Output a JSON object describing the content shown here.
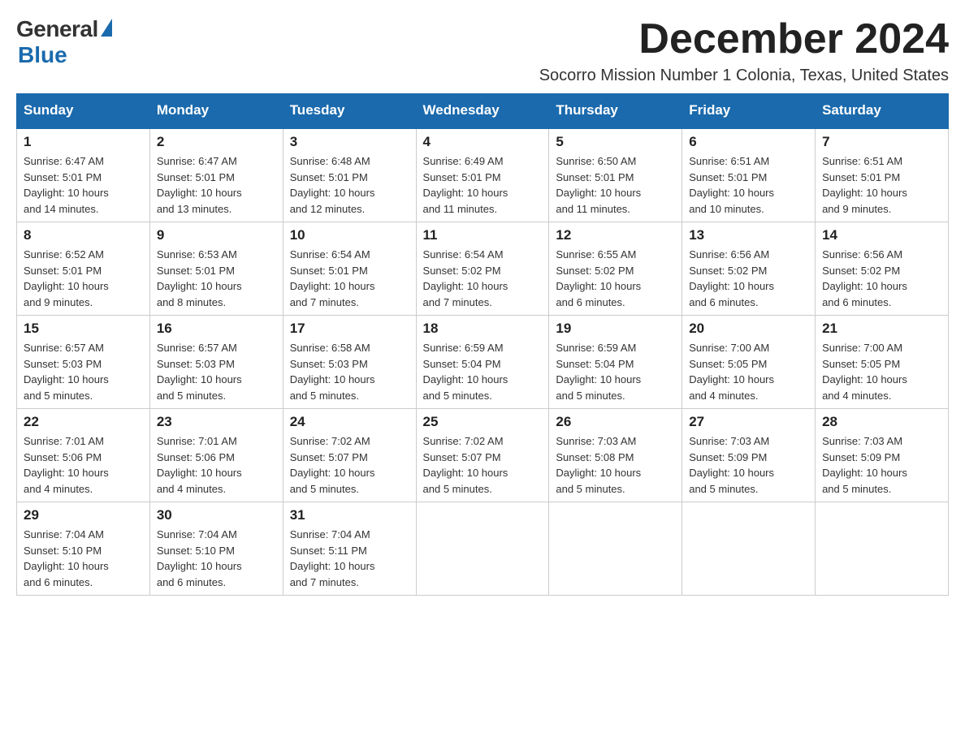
{
  "logo": {
    "general": "General",
    "blue": "Blue"
  },
  "title": "December 2024",
  "subtitle": "Socorro Mission Number 1 Colonia, Texas, United States",
  "weekdays": [
    "Sunday",
    "Monday",
    "Tuesday",
    "Wednesday",
    "Thursday",
    "Friday",
    "Saturday"
  ],
  "weeks": [
    [
      {
        "day": "1",
        "sunrise": "6:47 AM",
        "sunset": "5:01 PM",
        "daylight": "10 hours and 14 minutes."
      },
      {
        "day": "2",
        "sunrise": "6:47 AM",
        "sunset": "5:01 PM",
        "daylight": "10 hours and 13 minutes."
      },
      {
        "day": "3",
        "sunrise": "6:48 AM",
        "sunset": "5:01 PM",
        "daylight": "10 hours and 12 minutes."
      },
      {
        "day": "4",
        "sunrise": "6:49 AM",
        "sunset": "5:01 PM",
        "daylight": "10 hours and 11 minutes."
      },
      {
        "day": "5",
        "sunrise": "6:50 AM",
        "sunset": "5:01 PM",
        "daylight": "10 hours and 11 minutes."
      },
      {
        "day": "6",
        "sunrise": "6:51 AM",
        "sunset": "5:01 PM",
        "daylight": "10 hours and 10 minutes."
      },
      {
        "day": "7",
        "sunrise": "6:51 AM",
        "sunset": "5:01 PM",
        "daylight": "10 hours and 9 minutes."
      }
    ],
    [
      {
        "day": "8",
        "sunrise": "6:52 AM",
        "sunset": "5:01 PM",
        "daylight": "10 hours and 9 minutes."
      },
      {
        "day": "9",
        "sunrise": "6:53 AM",
        "sunset": "5:01 PM",
        "daylight": "10 hours and 8 minutes."
      },
      {
        "day": "10",
        "sunrise": "6:54 AM",
        "sunset": "5:01 PM",
        "daylight": "10 hours and 7 minutes."
      },
      {
        "day": "11",
        "sunrise": "6:54 AM",
        "sunset": "5:02 PM",
        "daylight": "10 hours and 7 minutes."
      },
      {
        "day": "12",
        "sunrise": "6:55 AM",
        "sunset": "5:02 PM",
        "daylight": "10 hours and 6 minutes."
      },
      {
        "day": "13",
        "sunrise": "6:56 AM",
        "sunset": "5:02 PM",
        "daylight": "10 hours and 6 minutes."
      },
      {
        "day": "14",
        "sunrise": "6:56 AM",
        "sunset": "5:02 PM",
        "daylight": "10 hours and 6 minutes."
      }
    ],
    [
      {
        "day": "15",
        "sunrise": "6:57 AM",
        "sunset": "5:03 PM",
        "daylight": "10 hours and 5 minutes."
      },
      {
        "day": "16",
        "sunrise": "6:57 AM",
        "sunset": "5:03 PM",
        "daylight": "10 hours and 5 minutes."
      },
      {
        "day": "17",
        "sunrise": "6:58 AM",
        "sunset": "5:03 PM",
        "daylight": "10 hours and 5 minutes."
      },
      {
        "day": "18",
        "sunrise": "6:59 AM",
        "sunset": "5:04 PM",
        "daylight": "10 hours and 5 minutes."
      },
      {
        "day": "19",
        "sunrise": "6:59 AM",
        "sunset": "5:04 PM",
        "daylight": "10 hours and 5 minutes."
      },
      {
        "day": "20",
        "sunrise": "7:00 AM",
        "sunset": "5:05 PM",
        "daylight": "10 hours and 4 minutes."
      },
      {
        "day": "21",
        "sunrise": "7:00 AM",
        "sunset": "5:05 PM",
        "daylight": "10 hours and 4 minutes."
      }
    ],
    [
      {
        "day": "22",
        "sunrise": "7:01 AM",
        "sunset": "5:06 PM",
        "daylight": "10 hours and 4 minutes."
      },
      {
        "day": "23",
        "sunrise": "7:01 AM",
        "sunset": "5:06 PM",
        "daylight": "10 hours and 4 minutes."
      },
      {
        "day": "24",
        "sunrise": "7:02 AM",
        "sunset": "5:07 PM",
        "daylight": "10 hours and 5 minutes."
      },
      {
        "day": "25",
        "sunrise": "7:02 AM",
        "sunset": "5:07 PM",
        "daylight": "10 hours and 5 minutes."
      },
      {
        "day": "26",
        "sunrise": "7:03 AM",
        "sunset": "5:08 PM",
        "daylight": "10 hours and 5 minutes."
      },
      {
        "day": "27",
        "sunrise": "7:03 AM",
        "sunset": "5:09 PM",
        "daylight": "10 hours and 5 minutes."
      },
      {
        "day": "28",
        "sunrise": "7:03 AM",
        "sunset": "5:09 PM",
        "daylight": "10 hours and 5 minutes."
      }
    ],
    [
      {
        "day": "29",
        "sunrise": "7:04 AM",
        "sunset": "5:10 PM",
        "daylight": "10 hours and 6 minutes."
      },
      {
        "day": "30",
        "sunrise": "7:04 AM",
        "sunset": "5:10 PM",
        "daylight": "10 hours and 6 minutes."
      },
      {
        "day": "31",
        "sunrise": "7:04 AM",
        "sunset": "5:11 PM",
        "daylight": "10 hours and 7 minutes."
      },
      null,
      null,
      null,
      null
    ]
  ],
  "labels": {
    "sunrise": "Sunrise:",
    "sunset": "Sunset:",
    "daylight": "Daylight:"
  }
}
